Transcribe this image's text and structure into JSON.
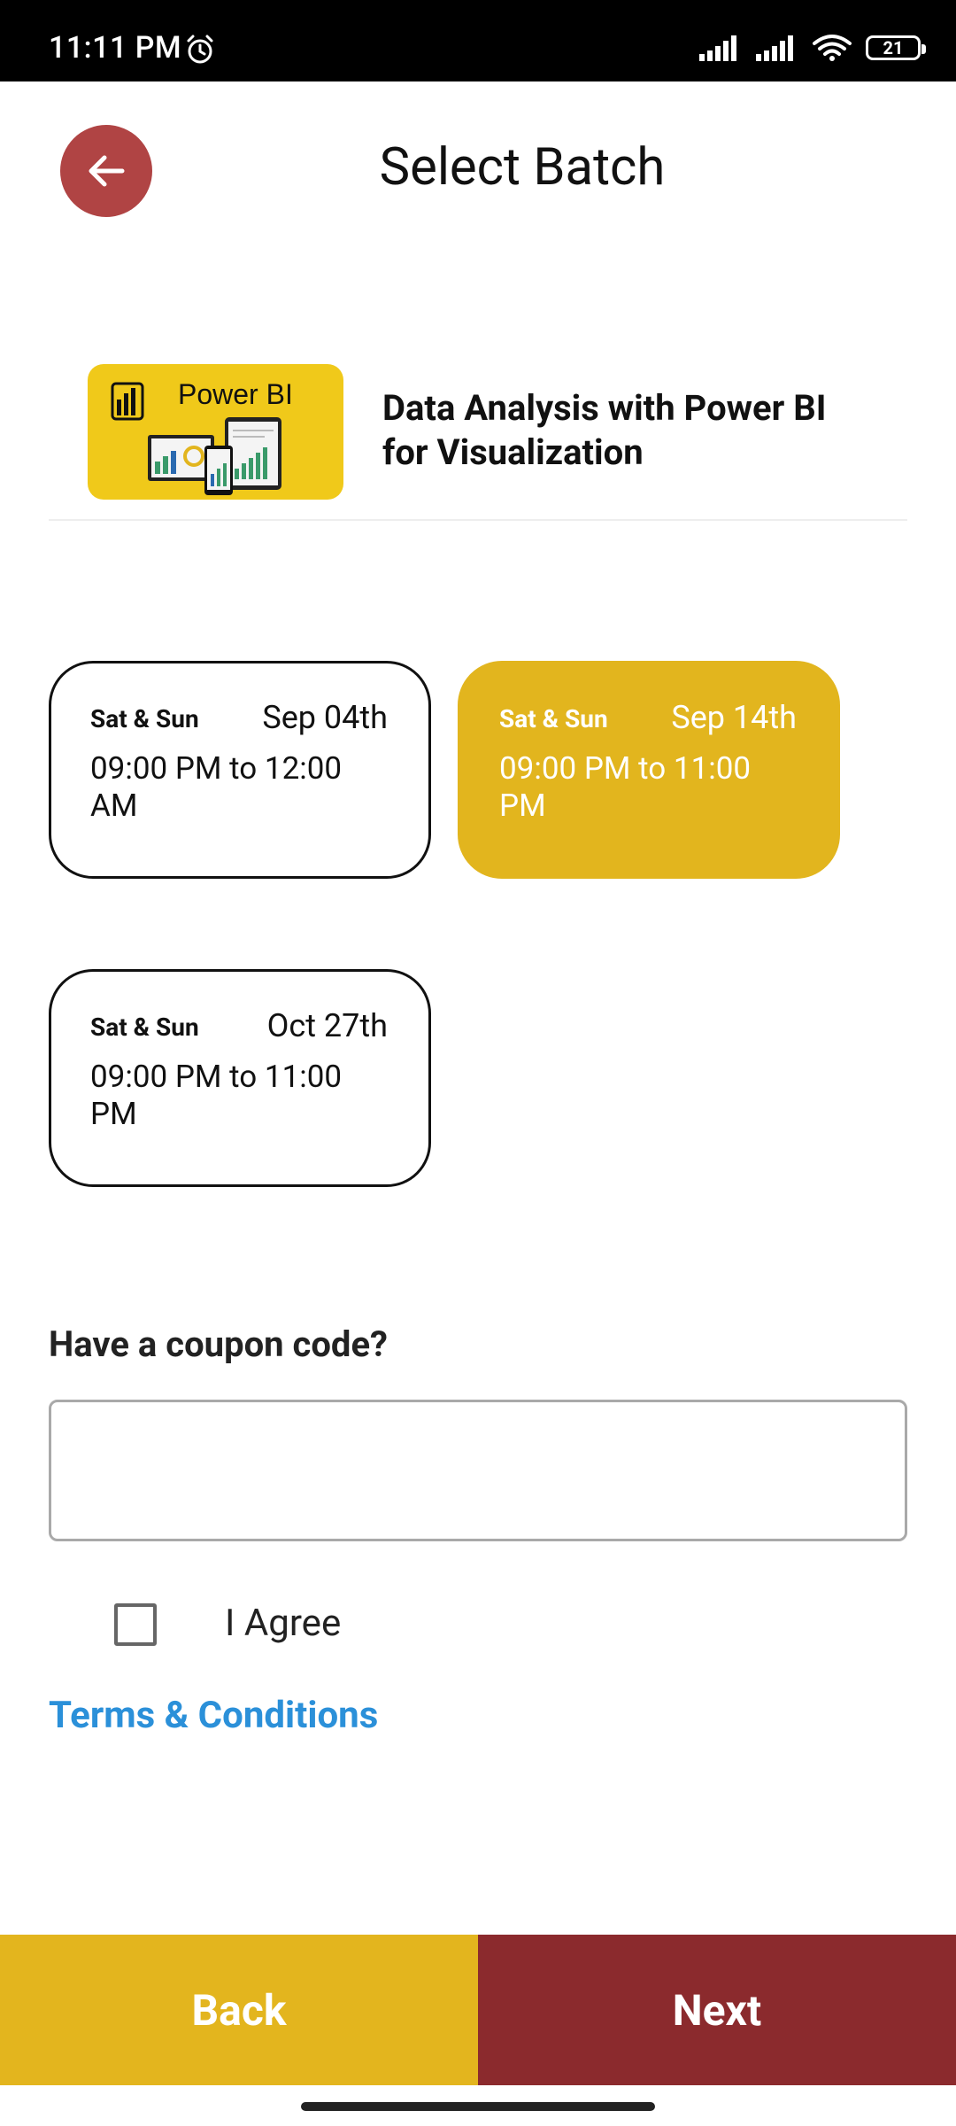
{
  "status": {
    "time": "11:11 PM",
    "battery": "21",
    "icons": [
      "alarm-icon",
      "signal-icon",
      "signal-icon",
      "wifi-icon",
      "battery-icon"
    ]
  },
  "header": {
    "title": "Select Batch",
    "back_icon": "arrow-left-icon"
  },
  "course": {
    "image_label": "Power BI",
    "title": "Data Analysis with Power BI for Visualization"
  },
  "batches": [
    {
      "days": "Sat & Sun",
      "date": "Sep 04th",
      "time": "09:00 PM to 12:00 AM",
      "selected": false
    },
    {
      "days": "Sat & Sun",
      "date": "Sep 14th",
      "time": "09:00 PM to 11:00 PM",
      "selected": true
    },
    {
      "days": "Sat & Sun",
      "date": "Oct 27th",
      "time": "09:00 PM to 11:00 PM",
      "selected": false
    }
  ],
  "coupon": {
    "label": "Have a coupon code?",
    "value": "",
    "placeholder": ""
  },
  "agreement": {
    "label": "I Agree",
    "checked": false,
    "terms_link": "Terms & Conditions"
  },
  "footer": {
    "back_label": "Back",
    "next_label": "Next"
  },
  "colors": {
    "accent_yellow": "#e2b51e",
    "accent_maroon": "#8b2a2d",
    "back_circle": "#b04444",
    "link_blue": "#2b90d9"
  }
}
